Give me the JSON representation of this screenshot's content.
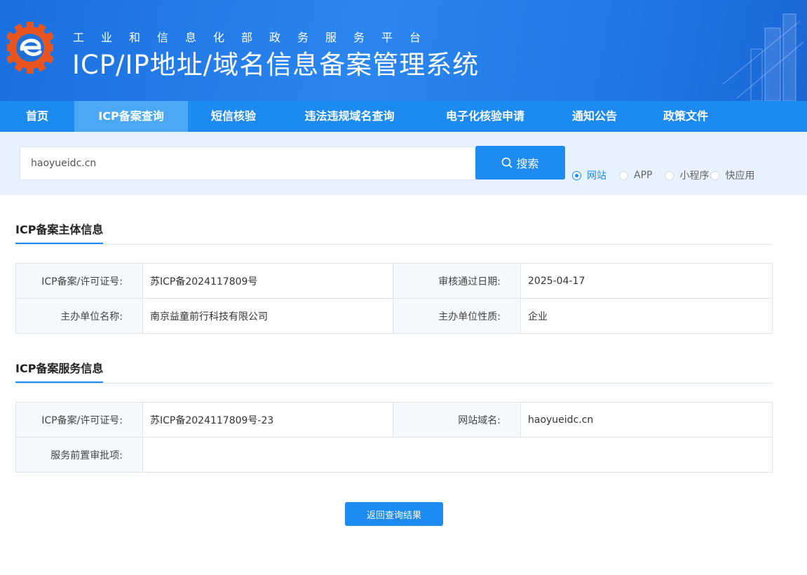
{
  "header": {
    "subtitle": "工业和信息化部政务服务平台",
    "title": "ICP/IP地址/域名信息备案管理系统"
  },
  "nav": {
    "items": [
      {
        "label": "首页",
        "active": false
      },
      {
        "label": "ICP备案查询",
        "active": true
      },
      {
        "label": "短信核验",
        "active": false
      },
      {
        "label": "违法违规域名查询",
        "active": false
      },
      {
        "label": "电子化核验申请",
        "active": false
      },
      {
        "label": "通知公告",
        "active": false
      },
      {
        "label": "政策文件",
        "active": false
      }
    ]
  },
  "search": {
    "value": "haoyueidc.cn",
    "button_label": "搜索",
    "options": [
      {
        "label": "网站",
        "checked": true
      },
      {
        "label": "APP",
        "checked": false
      },
      {
        "label": "小程序",
        "checked": false
      },
      {
        "label": "快应用",
        "checked": false
      }
    ]
  },
  "subject": {
    "title": "ICP备案主体信息",
    "license_label": "ICP备案/许可证号:",
    "license_value": "苏ICP备2024117809号",
    "approve_date_label": "审核通过日期:",
    "approve_date_value": "2025-04-17",
    "org_name_label": "主办单位名称:",
    "org_name_value": "南京益童前行科技有限公司",
    "org_type_label": "主办单位性质:",
    "org_type_value": "企业"
  },
  "service": {
    "title": "ICP备案服务信息",
    "license_label": "ICP备案/许可证号:",
    "license_value": "苏ICP备2024117809号-23",
    "domain_label": "网站域名:",
    "domain_value": "haoyueidc.cn",
    "preapproval_label": "服务前置审批项:",
    "preapproval_value": ""
  },
  "back_button": "返回查询结果",
  "colors": {
    "primary": "#1e8bf2",
    "nav_bg": "#1d8af1",
    "nav_active": "#4aa8f7",
    "search_band": "#e6f2fd"
  }
}
